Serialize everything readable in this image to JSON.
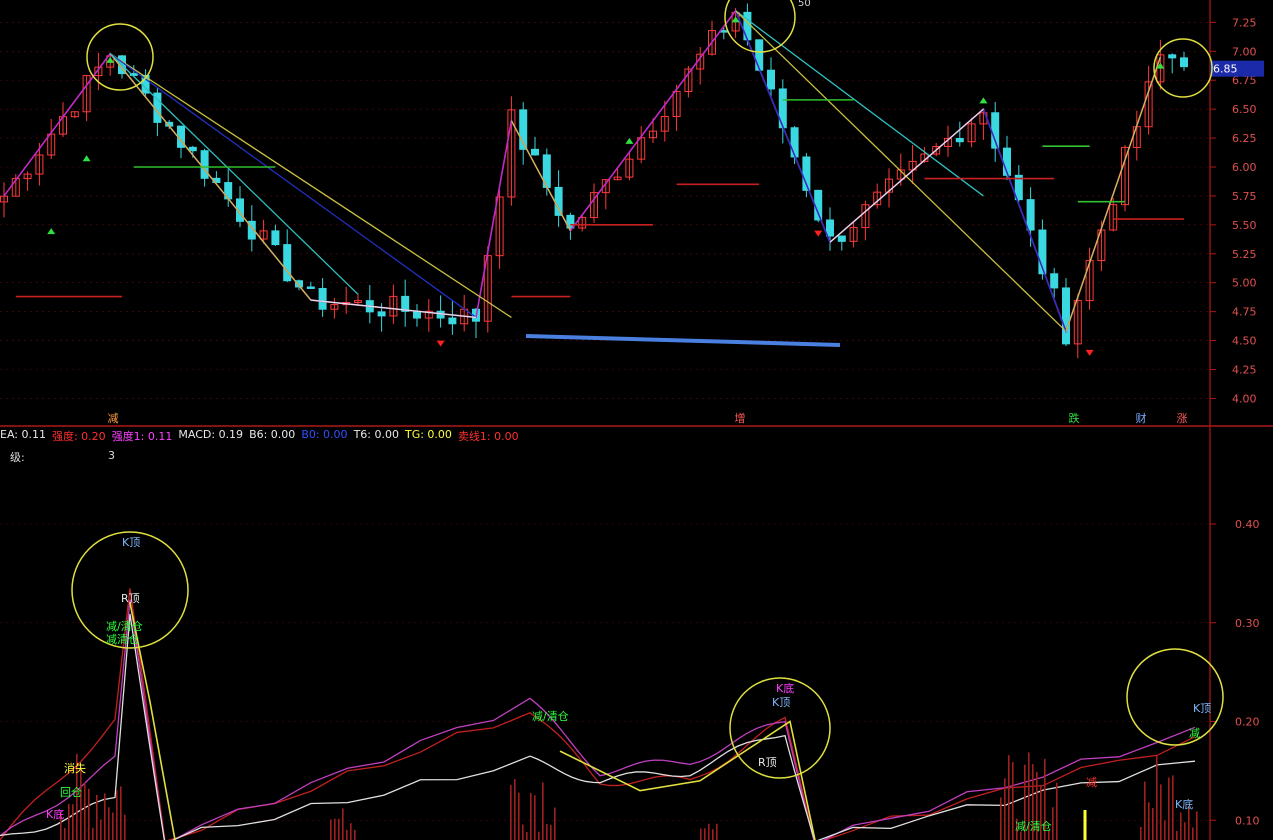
{
  "price_badge": "6.85",
  "top_axis_partial": "50",
  "upper_ticks": [
    "7.25",
    "7.00",
    "6.75",
    "6.50",
    "6.25",
    "6.00",
    "5.75",
    "5.50",
    "5.25",
    "5.00",
    "4.75",
    "4.50",
    "4.25",
    "4.00"
  ],
  "lower_ticks": [
    "0.40",
    "0.30",
    "0.20",
    "0.10"
  ],
  "markers": [
    {
      "text": "减",
      "color": "#ff9a40"
    },
    {
      "text": "增",
      "color": "#ff5a5a"
    },
    {
      "text": "跌",
      "color": "#30e040"
    },
    {
      "text": "财",
      "color": "#7fa8ff"
    },
    {
      "text": "涨",
      "color": "#ff5a5a"
    }
  ],
  "readout": [
    {
      "text": "EA: 0.11",
      "color": "#e8e8e8"
    },
    {
      "text": "强度: 0.20",
      "color": "#ff3030"
    },
    {
      "text": "强度1: 0.11",
      "color": "#ff40ff"
    },
    {
      "text": "MACD: 0.19",
      "color": "#e8e8e8"
    },
    {
      "text": "B6: 0.00",
      "color": "#e8e8e8"
    },
    {
      "text": "B0: 0.00",
      "color": "#3050ff"
    },
    {
      "text": "T6: 0.00",
      "color": "#e8e8e8"
    },
    {
      "text": "TG: 0.00",
      "color": "#ffff40"
    },
    {
      "text": "卖线1: 0.00",
      "color": "#ff3030"
    }
  ],
  "level_label": "级:",
  "level_value": "3",
  "annotations": [
    {
      "text": "K顶",
      "color": "#7fb8ff"
    },
    {
      "text": "R顶",
      "color": "#e8e8e8"
    },
    {
      "text": "减/清仓",
      "color": "#30ff40"
    },
    {
      "text": "减清仓",
      "color": "#30ff40"
    },
    {
      "text": "减/清仓",
      "color": "#30ff40"
    },
    {
      "text": "K底",
      "color": "#ff40ff"
    },
    {
      "text": "K顶",
      "color": "#7fb8ff"
    },
    {
      "text": "R顶",
      "color": "#e8e8e8"
    },
    {
      "text": "减",
      "color": "#ff3030"
    },
    {
      "text": "减/清仓",
      "color": "#30ff40"
    },
    {
      "text": "K底",
      "color": "#7fb8ff"
    },
    {
      "text": "K顶",
      "color": "#7fb8ff"
    },
    {
      "text": "减",
      "color": "#30ff40"
    },
    {
      "text": "消失",
      "color": "#ffff40"
    },
    {
      "text": "回仓",
      "color": "#30ff40"
    },
    {
      "text": "K底",
      "color": "#ff40ff"
    }
  ],
  "chart_data": [
    {
      "type": "candlestick",
      "ylim": [
        3.9,
        7.4
      ],
      "zigzag_pivots": [
        {
          "i": 0,
          "price": 5.75
        },
        {
          "i": 9,
          "price": 6.98
        },
        {
          "i": 26,
          "price": 4.85
        },
        {
          "i": 40,
          "price": 4.7
        },
        {
          "i": 43,
          "price": 6.4
        },
        {
          "i": 48,
          "price": 5.45
        },
        {
          "i": 62,
          "price": 7.35
        },
        {
          "i": 70,
          "price": 5.35
        },
        {
          "i": 83,
          "price": 6.5
        },
        {
          "i": 90,
          "price": 4.58
        },
        {
          "i": 98,
          "price": 6.95
        }
      ],
      "last_price": 6.85,
      "grid": true
    },
    {
      "type": "line",
      "ylim": [
        0.08,
        0.48
      ],
      "series": [
        {
          "values": [
            0.08,
            0.2,
            0.33,
            0.08,
            0.21,
            0.14,
            0.14,
            0.2,
            0.08,
            0.18
          ]
        },
        {
          "values": [
            0.08,
            0.16,
            0.32,
            0.08,
            0.22,
            0.15,
            0.16,
            0.2,
            0.08,
            0.19
          ]
        },
        {
          "values": [
            0.08,
            0.12,
            0.31,
            0.08,
            0.16,
            0.14,
            0.15,
            0.19,
            0.08,
            0.16
          ]
        }
      ],
      "grid": true
    }
  ]
}
